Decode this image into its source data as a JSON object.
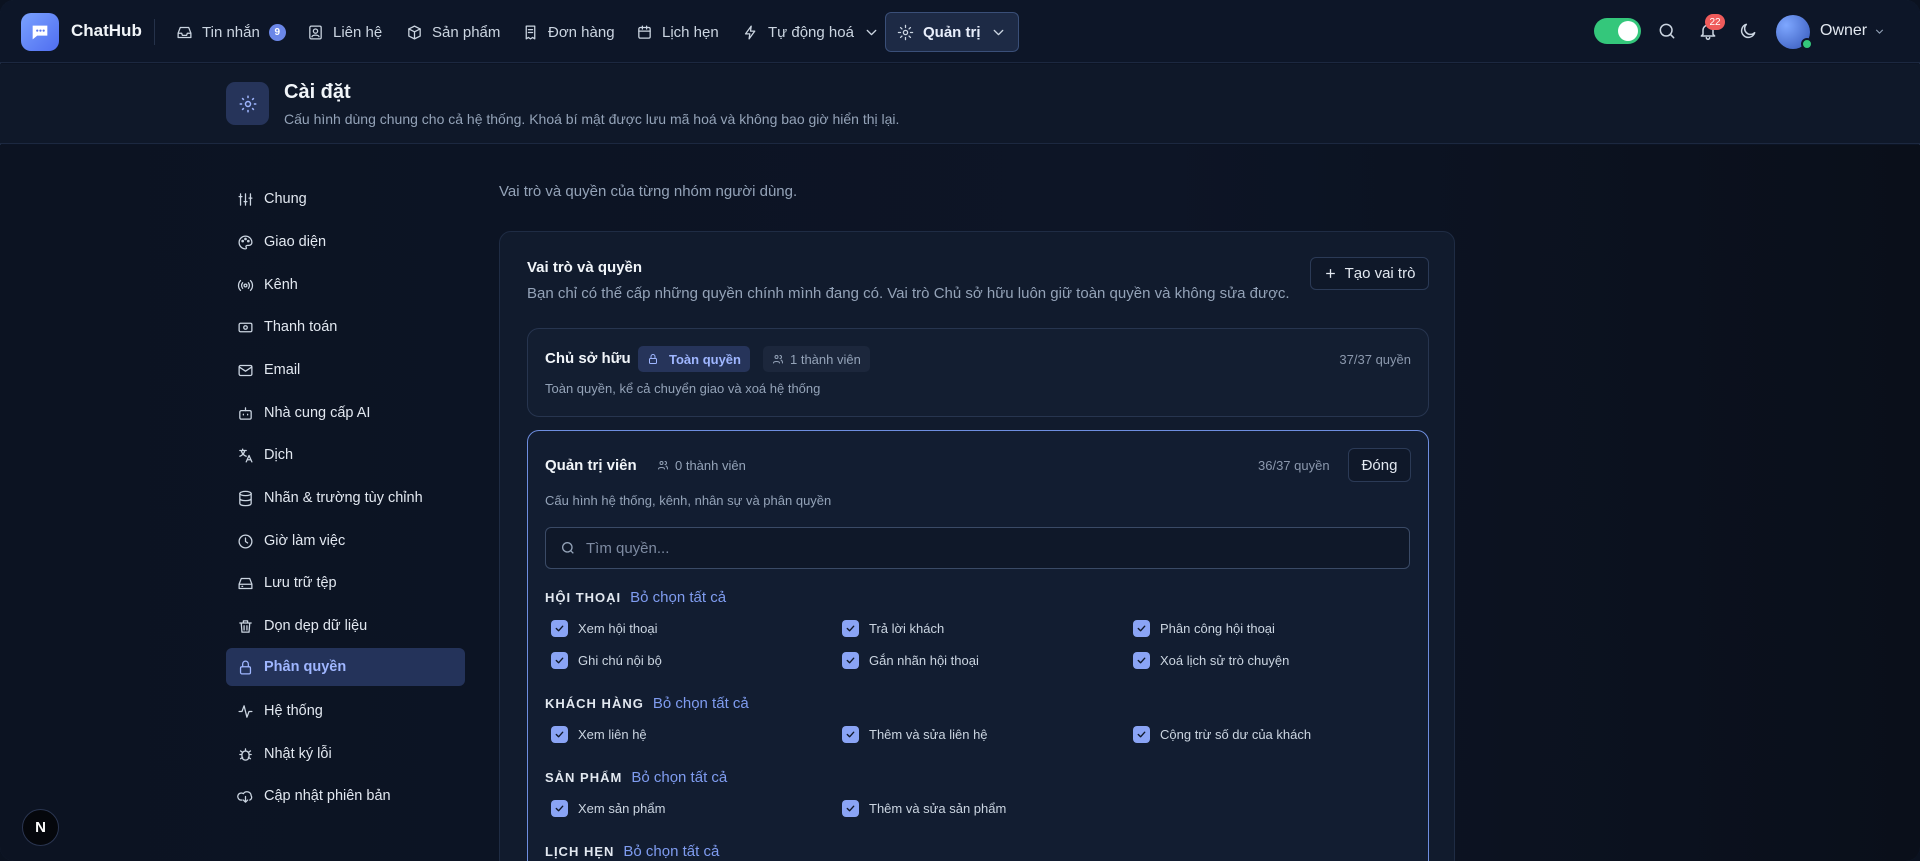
{
  "app": {
    "brand": "ChatHub",
    "user": "Owner",
    "notifications": "22"
  },
  "nav": [
    {
      "label": "Tin nhắn",
      "badge": "9"
    },
    {
      "label": "Liên hệ"
    },
    {
      "label": "Sản phẩm"
    },
    {
      "label": "Đơn hàng"
    },
    {
      "label": "Lịch hẹn"
    },
    {
      "label": "Tự động hoá"
    },
    {
      "label": "Quản trị"
    }
  ],
  "header": {
    "title": "Cài đặt",
    "subtitle": "Cấu hình dùng chung cho cả hệ thống. Khoá bí mật được lưu mã hoá và không bao giờ hiển thị lại."
  },
  "sidebar": [
    "Chung",
    "Giao diện",
    "Kênh",
    "Thanh toán",
    "Email",
    "Nhà cung cấp AI",
    "Dịch",
    "Nhãn & trường tùy chỉnh",
    "Giờ làm việc",
    "Lưu trữ tệp",
    "Dọn dẹp dữ liệu",
    "Phân quyền",
    "Hệ thống",
    "Nhật ký lỗi",
    "Cập nhật phiên bản"
  ],
  "intro": "Vai trò và quyền của từng nhóm người dùng.",
  "roles_card": {
    "title": "Vai trò và quyền",
    "subtitle": "Bạn chỉ có thể cấp những quyền chính mình đang có. Vai trò Chủ sở hữu luôn giữ toàn quyền và không sửa được.",
    "create_button": "Tạo vai trò"
  },
  "owner_role": {
    "name": "Chủ sở hữu",
    "perm_chip": "Toàn quyền",
    "members": "1 thành viên",
    "count": "37/37 quyền",
    "desc": "Toàn quyền, kể cả chuyển giao và xoá hệ thống"
  },
  "admin_role": {
    "name": "Quản trị viên",
    "members": "0 thành viên",
    "count": "36/37 quyền",
    "close_button": "Đóng",
    "desc": "Cấu hình hệ thống, kênh, nhân sự và phân quyền",
    "search_placeholder": "Tìm quyền..."
  },
  "groups": [
    {
      "name": "HỘI THOẠI",
      "link": "Bỏ chọn tất cả",
      "perms": [
        "Xem hội thoại",
        "Trả lời khách",
        "Phân công hội thoại",
        "Ghi chú nội bộ",
        "Gắn nhãn hội thoại",
        "Xoá lịch sử trò chuyện"
      ]
    },
    {
      "name": "KHÁCH HÀNG",
      "link": "Bỏ chọn tất cả",
      "perms": [
        "Xem liên hệ",
        "Thêm và sửa liên hệ",
        "Cộng trừ số dư của khách"
      ]
    },
    {
      "name": "SẢN PHẨM",
      "link": "Bỏ chọn tất cả",
      "perms": [
        "Xem sản phẩm",
        "Thêm và sửa sản phẩm"
      ]
    },
    {
      "name": "LỊCH HẸN",
      "link": "Bỏ chọn tất cả",
      "perms": []
    }
  ],
  "dev_badge": "N",
  "colors": {
    "accent": "#8aa4f5",
    "toggle": "#34c77b",
    "bg": "#0c1424"
  }
}
